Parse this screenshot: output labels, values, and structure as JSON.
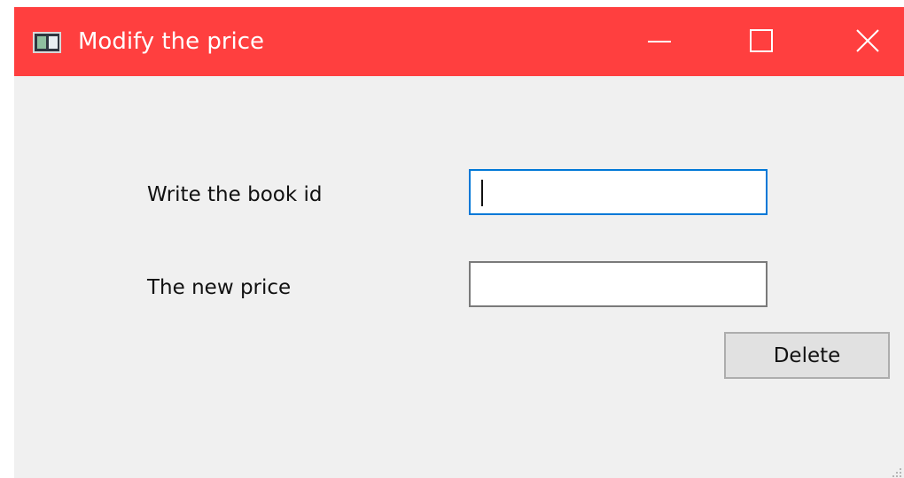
{
  "window": {
    "title": "Modify the price",
    "titlebar_color": "#ff3f3f",
    "icons": {
      "app": "app-window-icon",
      "minimize": "minimize-icon",
      "maximize": "maximize-icon",
      "close": "close-icon"
    }
  },
  "form": {
    "book_id_label": "Write the book id",
    "book_id_value": "",
    "price_label": "The new price",
    "price_value": "",
    "delete_button_label": "Delete"
  }
}
